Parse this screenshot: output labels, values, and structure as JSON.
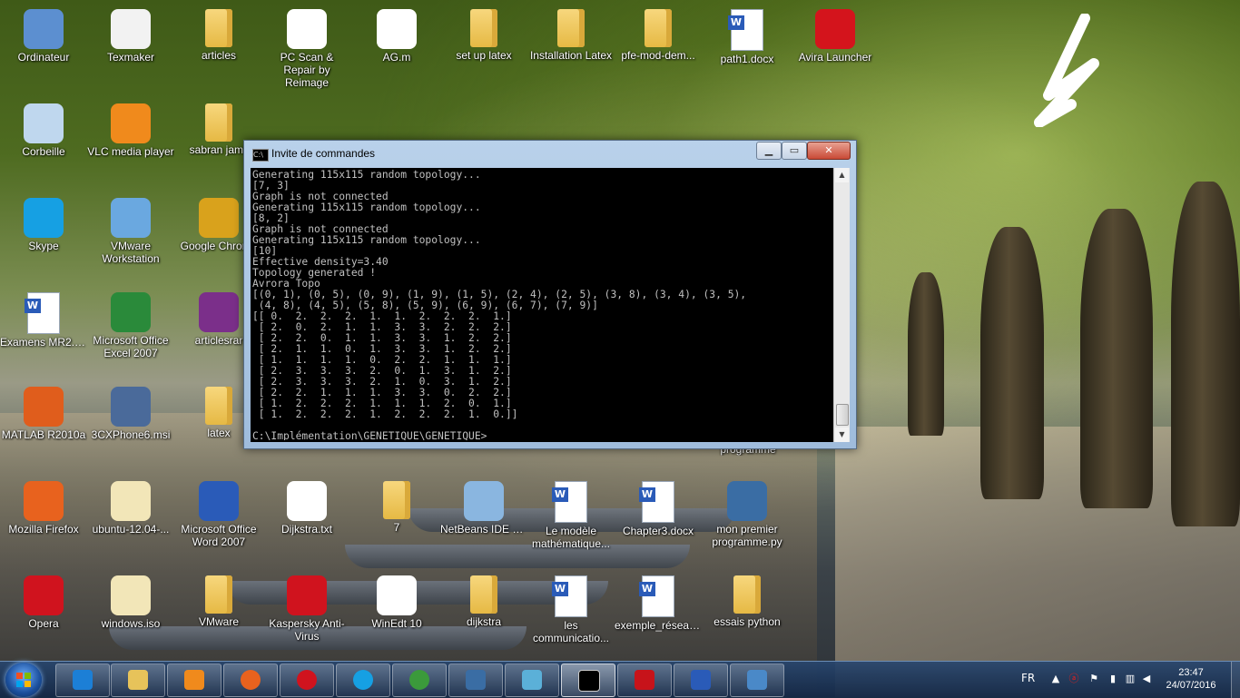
{
  "desktop": {
    "icons": [
      {
        "label": "Ordinateur",
        "icon": "computer-icon"
      },
      {
        "label": "Texmaker",
        "icon": "texmaker-icon"
      },
      {
        "label": "articles",
        "icon": "folder-icon"
      },
      {
        "label": "PC Scan & Repair by Reimage",
        "icon": "reimage-icon"
      },
      {
        "label": "AG.m",
        "icon": "matlab-file-icon"
      },
      {
        "label": "set up latex",
        "icon": "folder-icon"
      },
      {
        "label": "Installation Latex",
        "icon": "folder-icon"
      },
      {
        "label": "pfe-mod-dem...",
        "icon": "folder-icon"
      },
      {
        "label": "path1.docx",
        "icon": "word-doc-icon"
      },
      {
        "label": "Avira Launcher",
        "icon": "avira-icon"
      },
      {
        "label": "Corbeille",
        "icon": "recycle-bin-icon"
      },
      {
        "label": "VLC media player",
        "icon": "vlc-icon"
      },
      {
        "label": "sabran jamil",
        "icon": "folder-icon"
      },
      {
        "label": "Skype",
        "icon": "skype-icon"
      },
      {
        "label": "VMware Workstation",
        "icon": "vmware-icon"
      },
      {
        "label": "Google Chrome",
        "icon": "chrome-icon"
      },
      {
        "label": "Examens MR2.docx",
        "icon": "word-doc-icon"
      },
      {
        "label": "Microsoft Office Excel 2007",
        "icon": "excel-icon"
      },
      {
        "label": "articlesrar",
        "icon": "winrar-icon"
      },
      {
        "label": "MATLAB R2010a",
        "icon": "matlab-icon"
      },
      {
        "label": "3CXPhone6.msi",
        "icon": "installer-icon"
      },
      {
        "label": "latex",
        "icon": "folder-icon"
      },
      {
        "label": "programme",
        "icon": "python-icon"
      },
      {
        "label": "Mozilla Firefox",
        "icon": "firefox-icon"
      },
      {
        "label": "ubuntu-12.04-...",
        "icon": "iso-icon"
      },
      {
        "label": "Microsoft Office Word 2007",
        "icon": "word-icon"
      },
      {
        "label": "Dijkstra.txt",
        "icon": "text-file-icon"
      },
      {
        "label": "7",
        "icon": "folder-icon"
      },
      {
        "label": "NetBeans IDE 8.1",
        "icon": "netbeans-icon"
      },
      {
        "label": "Le modèle mathématique...",
        "icon": "word-doc-icon"
      },
      {
        "label": "Chapter3.docx",
        "icon": "word-doc-icon"
      },
      {
        "label": "mon premier programme.py",
        "icon": "python-icon"
      },
      {
        "label": "Opera",
        "icon": "opera-icon"
      },
      {
        "label": "windows.iso",
        "icon": "iso-icon"
      },
      {
        "label": "VMware",
        "icon": "folder-icon"
      },
      {
        "label": "Kaspersky Anti-Virus",
        "icon": "kaspersky-icon"
      },
      {
        "label": "WinEdt 10",
        "icon": "winedt-icon"
      },
      {
        "label": "dijkstra",
        "icon": "folder-icon"
      },
      {
        "label": "les communicatio...",
        "icon": "word-doc-icon"
      },
      {
        "label": "exemple_réseau...",
        "icon": "word-doc-icon"
      },
      {
        "label": "essais python",
        "icon": "folder-icon"
      }
    ]
  },
  "console_window": {
    "title": "Invite de commandes",
    "lines": [
      "Generating 115x115 random topology...",
      "[7, 3]",
      "Graph is not connected",
      "Generating 115x115 random topology...",
      "[8, 2]",
      "Graph is not connected",
      "Generating 115x115 random topology...",
      "[10]",
      "Effective density=3.40",
      "Topology generated !",
      "Avrora Topo",
      "[(0, 1), (0, 5), (0, 9), (1, 9), (1, 5), (2, 4), (2, 5), (3, 8), (3, 4), (3, 5),",
      " (4, 8), (4, 5), (5, 8), (5, 9), (6, 9), (6, 7), (7, 9)]",
      "[[ 0.  2.  2.  2.  1.  1.  2.  2.  2.  1.]",
      " [ 2.  0.  2.  1.  1.  3.  3.  2.  2.  2.]",
      " [ 2.  2.  0.  1.  1.  3.  3.  1.  2.  2.]",
      " [ 2.  1.  1.  0.  1.  3.  3.  1.  2.  2.]",
      " [ 1.  1.  1.  1.  0.  2.  2.  1.  1.  1.]",
      " [ 2.  3.  3.  3.  2.  0.  1.  3.  1.  2.]",
      " [ 2.  3.  3.  3.  2.  1.  0.  3.  1.  2.]",
      " [ 2.  2.  1.  1.  1.  3.  3.  0.  2.  2.]",
      " [ 1.  2.  2.  2.  1.  1.  1.  2.  0.  1.]",
      " [ 1.  2.  2.  2.  1.  2.  2.  2.  1.  0.]]",
      "",
      "C:\\Implémentation\\GENETIQUE\\GENETIQUE>"
    ],
    "buttons": {
      "minimize": "minimize",
      "maximize": "maximize",
      "close": "close"
    }
  },
  "taskbar": {
    "apps": [
      {
        "name": "Internet Explorer",
        "icon": "ie-icon",
        "color": "#1c7fd6"
      },
      {
        "name": "Windows Explorer",
        "icon": "explorer-icon",
        "color": "#e7c35a"
      },
      {
        "name": "Windows Media Player",
        "icon": "media-player-icon",
        "color": "#f08a1c"
      },
      {
        "name": "Firefox",
        "icon": "firefox-icon",
        "color": "#e8621e"
      },
      {
        "name": "Opera",
        "icon": "opera-icon",
        "color": "#d0131e"
      },
      {
        "name": "Skype",
        "icon": "skype-icon",
        "color": "#16a0e3"
      },
      {
        "name": "Google Chrome",
        "icon": "chrome-icon",
        "color": "#3b9a3b"
      },
      {
        "name": "Python",
        "icon": "python-icon",
        "color": "#3a6da4"
      },
      {
        "name": "Note",
        "icon": "note-icon",
        "color": "#5bb0d8"
      },
      {
        "name": "Invite de commandes",
        "icon": "cmd-icon",
        "color": "#000000",
        "active": true
      },
      {
        "name": "Adobe Reader",
        "icon": "pdf-icon",
        "color": "#c7131a"
      },
      {
        "name": "Microsoft Word",
        "icon": "word-icon",
        "color": "#2a5bb8"
      },
      {
        "name": "Photos",
        "icon": "photo-viewer-icon",
        "color": "#4a89c8"
      }
    ],
    "language": "FR",
    "time": "23:47",
    "date": "24/07/2016"
  }
}
